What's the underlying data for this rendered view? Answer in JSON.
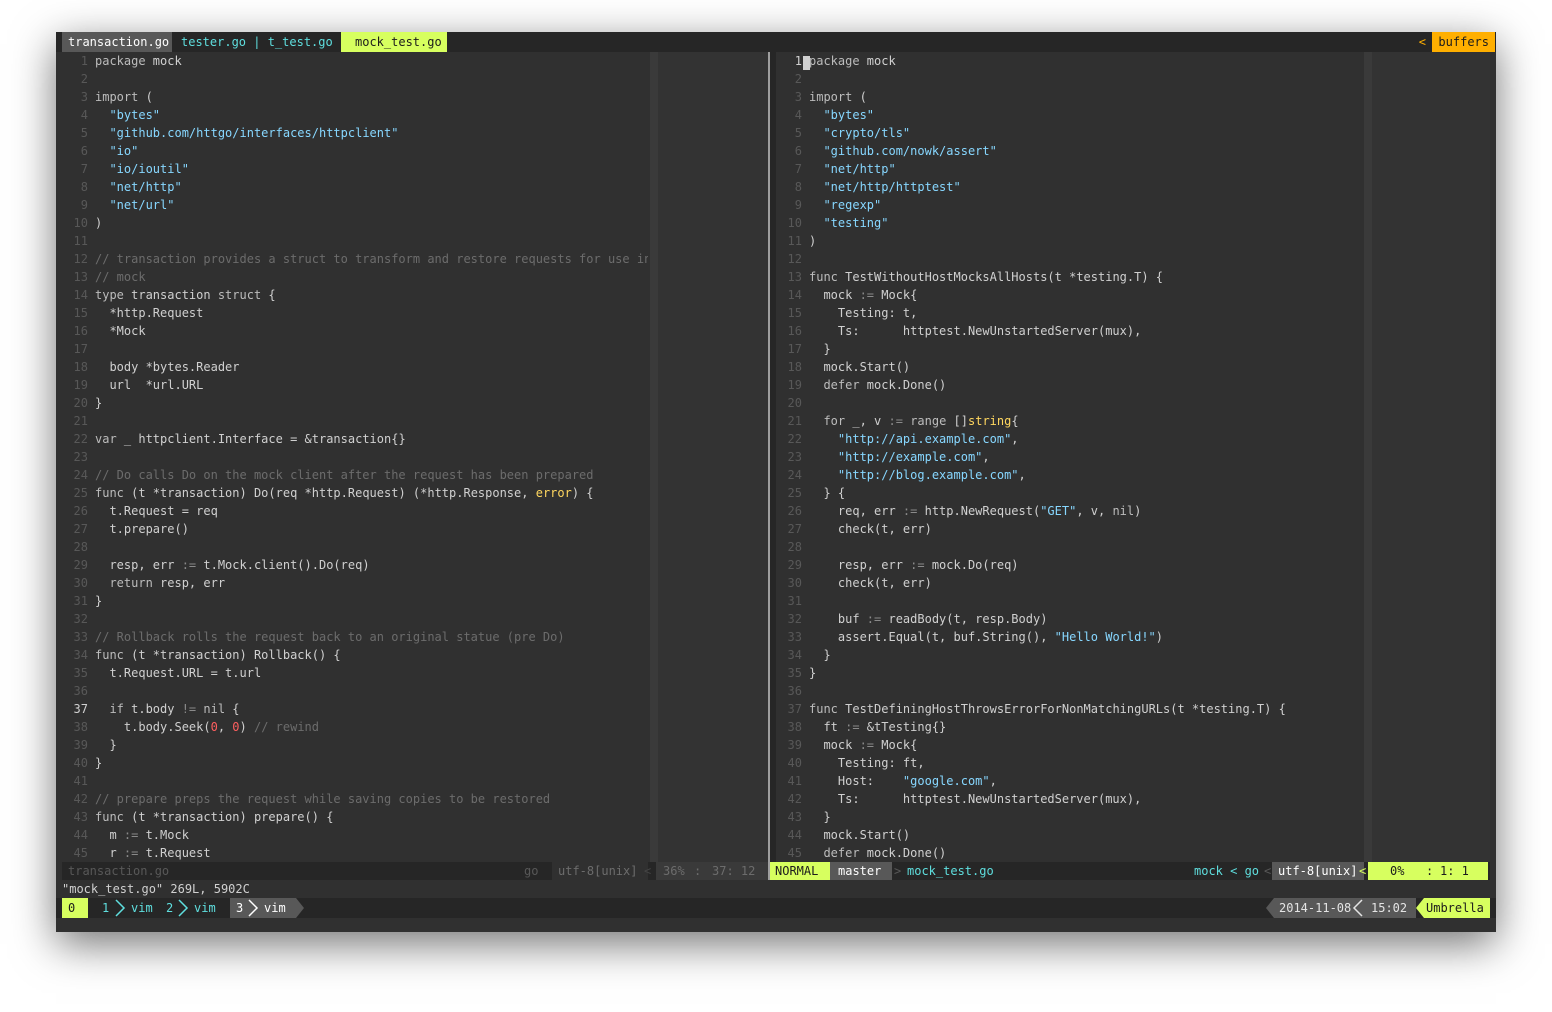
{
  "tabs": {
    "active": "transaction.go",
    "mid": "tester.go | t_test.go",
    "current": "mock_test.go",
    "buffers_arrow": "<",
    "buffers": "buffers"
  },
  "left_pane": {
    "lines": [
      {
        "n": "1",
        "t": "package mock"
      },
      {
        "n": "2",
        "t": ""
      },
      {
        "n": "3",
        "t": "import ("
      },
      {
        "n": "4",
        "t": "  \"bytes\""
      },
      {
        "n": "5",
        "t": "  \"github.com/httgo/interfaces/httpclient\""
      },
      {
        "n": "6",
        "t": "  \"io\""
      },
      {
        "n": "7",
        "t": "  \"io/ioutil\""
      },
      {
        "n": "8",
        "t": "  \"net/http\""
      },
      {
        "n": "9",
        "t": "  \"net/url\""
      },
      {
        "n": "10",
        "t": ")"
      },
      {
        "n": "11",
        "t": ""
      },
      {
        "n": "12",
        "t": "// transaction provides a struct to transform and restore requests for use in"
      },
      {
        "n": "13",
        "t": "// mock"
      },
      {
        "n": "14",
        "t": "type transaction struct {"
      },
      {
        "n": "15",
        "t": "  *http.Request"
      },
      {
        "n": "16",
        "t": "  *Mock"
      },
      {
        "n": "17",
        "t": ""
      },
      {
        "n": "18",
        "t": "  body *bytes.Reader"
      },
      {
        "n": "19",
        "t": "  url  *url.URL"
      },
      {
        "n": "20",
        "t": "}"
      },
      {
        "n": "21",
        "t": ""
      },
      {
        "n": "22",
        "t": "var _ httpclient.Interface = &transaction{}"
      },
      {
        "n": "23",
        "t": ""
      },
      {
        "n": "24",
        "t": "// Do calls Do on the mock client after the request has been prepared"
      },
      {
        "n": "25",
        "t": "func (t *transaction) Do(req *http.Request) (*http.Response, error) {"
      },
      {
        "n": "26",
        "t": "  t.Request = req"
      },
      {
        "n": "27",
        "t": "  t.prepare()"
      },
      {
        "n": "28",
        "t": ""
      },
      {
        "n": "29",
        "t": "  resp, err := t.Mock.client().Do(req)"
      },
      {
        "n": "30",
        "t": "  return resp, err"
      },
      {
        "n": "31",
        "t": "}"
      },
      {
        "n": "32",
        "t": ""
      },
      {
        "n": "33",
        "t": "// Rollback rolls the request back to an original statue (pre Do)"
      },
      {
        "n": "34",
        "t": "func (t *transaction) Rollback() {"
      },
      {
        "n": "35",
        "t": "  t.Request.URL = t.url"
      },
      {
        "n": "36",
        "t": ""
      },
      {
        "n": "37",
        "t": "  if t.body != nil {"
      },
      {
        "n": "38",
        "t": "    t.body.Seek(0, 0) // rewind"
      },
      {
        "n": "39",
        "t": "  }"
      },
      {
        "n": "40",
        "t": "}"
      },
      {
        "n": "41",
        "t": ""
      },
      {
        "n": "42",
        "t": "// prepare preps the request while saving copies to be restored"
      },
      {
        "n": "43",
        "t": "func (t *transaction) prepare() {"
      },
      {
        "n": "44",
        "t": "  m := t.Mock"
      },
      {
        "n": "45",
        "t": "  r := t.Request"
      }
    ]
  },
  "right_pane": {
    "lines": [
      {
        "n": "1",
        "t": "package mock"
      },
      {
        "n": "2",
        "t": ""
      },
      {
        "n": "3",
        "t": "import ("
      },
      {
        "n": "4",
        "t": "  \"bytes\""
      },
      {
        "n": "5",
        "t": "  \"crypto/tls\""
      },
      {
        "n": "6",
        "t": "  \"github.com/nowk/assert\""
      },
      {
        "n": "7",
        "t": "  \"net/http\""
      },
      {
        "n": "8",
        "t": "  \"net/http/httptest\""
      },
      {
        "n": "9",
        "t": "  \"regexp\""
      },
      {
        "n": "10",
        "t": "  \"testing\""
      },
      {
        "n": "11",
        "t": ")"
      },
      {
        "n": "12",
        "t": ""
      },
      {
        "n": "13",
        "t": "func TestWithoutHostMocksAllHosts(t *testing.T) {"
      },
      {
        "n": "14",
        "t": "  mock := Mock{"
      },
      {
        "n": "15",
        "t": "    Testing: t,"
      },
      {
        "n": "16",
        "t": "    Ts:      httptest.NewUnstartedServer(mux),"
      },
      {
        "n": "17",
        "t": "  }"
      },
      {
        "n": "18",
        "t": "  mock.Start()"
      },
      {
        "n": "19",
        "t": "  defer mock.Done()"
      },
      {
        "n": "20",
        "t": ""
      },
      {
        "n": "21",
        "t": "  for _, v := range []string{"
      },
      {
        "n": "22",
        "t": "    \"http://api.example.com\","
      },
      {
        "n": "23",
        "t": "    \"http://example.com\","
      },
      {
        "n": "24",
        "t": "    \"http://blog.example.com\","
      },
      {
        "n": "25",
        "t": "  } {"
      },
      {
        "n": "26",
        "t": "    req, err := http.NewRequest(\"GET\", v, nil)"
      },
      {
        "n": "27",
        "t": "    check(t, err)"
      },
      {
        "n": "28",
        "t": ""
      },
      {
        "n": "29",
        "t": "    resp, err := mock.Do(req)"
      },
      {
        "n": "30",
        "t": "    check(t, err)"
      },
      {
        "n": "31",
        "t": ""
      },
      {
        "n": "32",
        "t": "    buf := readBody(t, resp.Body)"
      },
      {
        "n": "33",
        "t": "    assert.Equal(t, buf.String(), \"Hello World!\")"
      },
      {
        "n": "34",
        "t": "  }"
      },
      {
        "n": "35",
        "t": "}"
      },
      {
        "n": "36",
        "t": ""
      },
      {
        "n": "37",
        "t": "func TestDefiningHostThrowsErrorForNonMatchingURLs(t *testing.T) {"
      },
      {
        "n": "38",
        "t": "  ft := &tTesting{}"
      },
      {
        "n": "39",
        "t": "  mock := Mock{"
      },
      {
        "n": "40",
        "t": "    Testing: ft,"
      },
      {
        "n": "41",
        "t": "    Host:    \"google.com\","
      },
      {
        "n": "42",
        "t": "    Ts:      httptest.NewUnstartedServer(mux),"
      },
      {
        "n": "43",
        "t": "  }"
      },
      {
        "n": "44",
        "t": "  mock.Start()"
      },
      {
        "n": "45",
        "t": "  defer mock.Done()"
      }
    ]
  },
  "status_left": {
    "file": "transaction.go",
    "filetype": "go",
    "encoding": "utf-8[unix]",
    "sep": "<",
    "percent": "36%",
    "position": "37: 12"
  },
  "status_right": {
    "mode": "NORMAL",
    "branch": "master",
    "sep1": ">",
    "file": "mock_test.go",
    "package": "mock < go",
    "sep2": "<",
    "encoding": "utf-8[unix]",
    "sep3": "<",
    "percent": "0%",
    "position": "1:  1"
  },
  "cmdline": "\"mock_test.go\" 269L, 5902C",
  "tmux": {
    "session": "0",
    "windows": [
      {
        "index": "1",
        "name": "vim"
      },
      {
        "index": "2",
        "name": "vim"
      },
      {
        "index": "3",
        "name": "vim"
      }
    ],
    "date": "2014-11-08",
    "time": "15:02",
    "host": "Umbrella"
  },
  "colors": {
    "background": "#303030",
    "accent_lime": "#d7ff5f",
    "accent_orange": "#ffaf00",
    "cyan": "#5fdfdf",
    "string": "#87d7ff"
  }
}
